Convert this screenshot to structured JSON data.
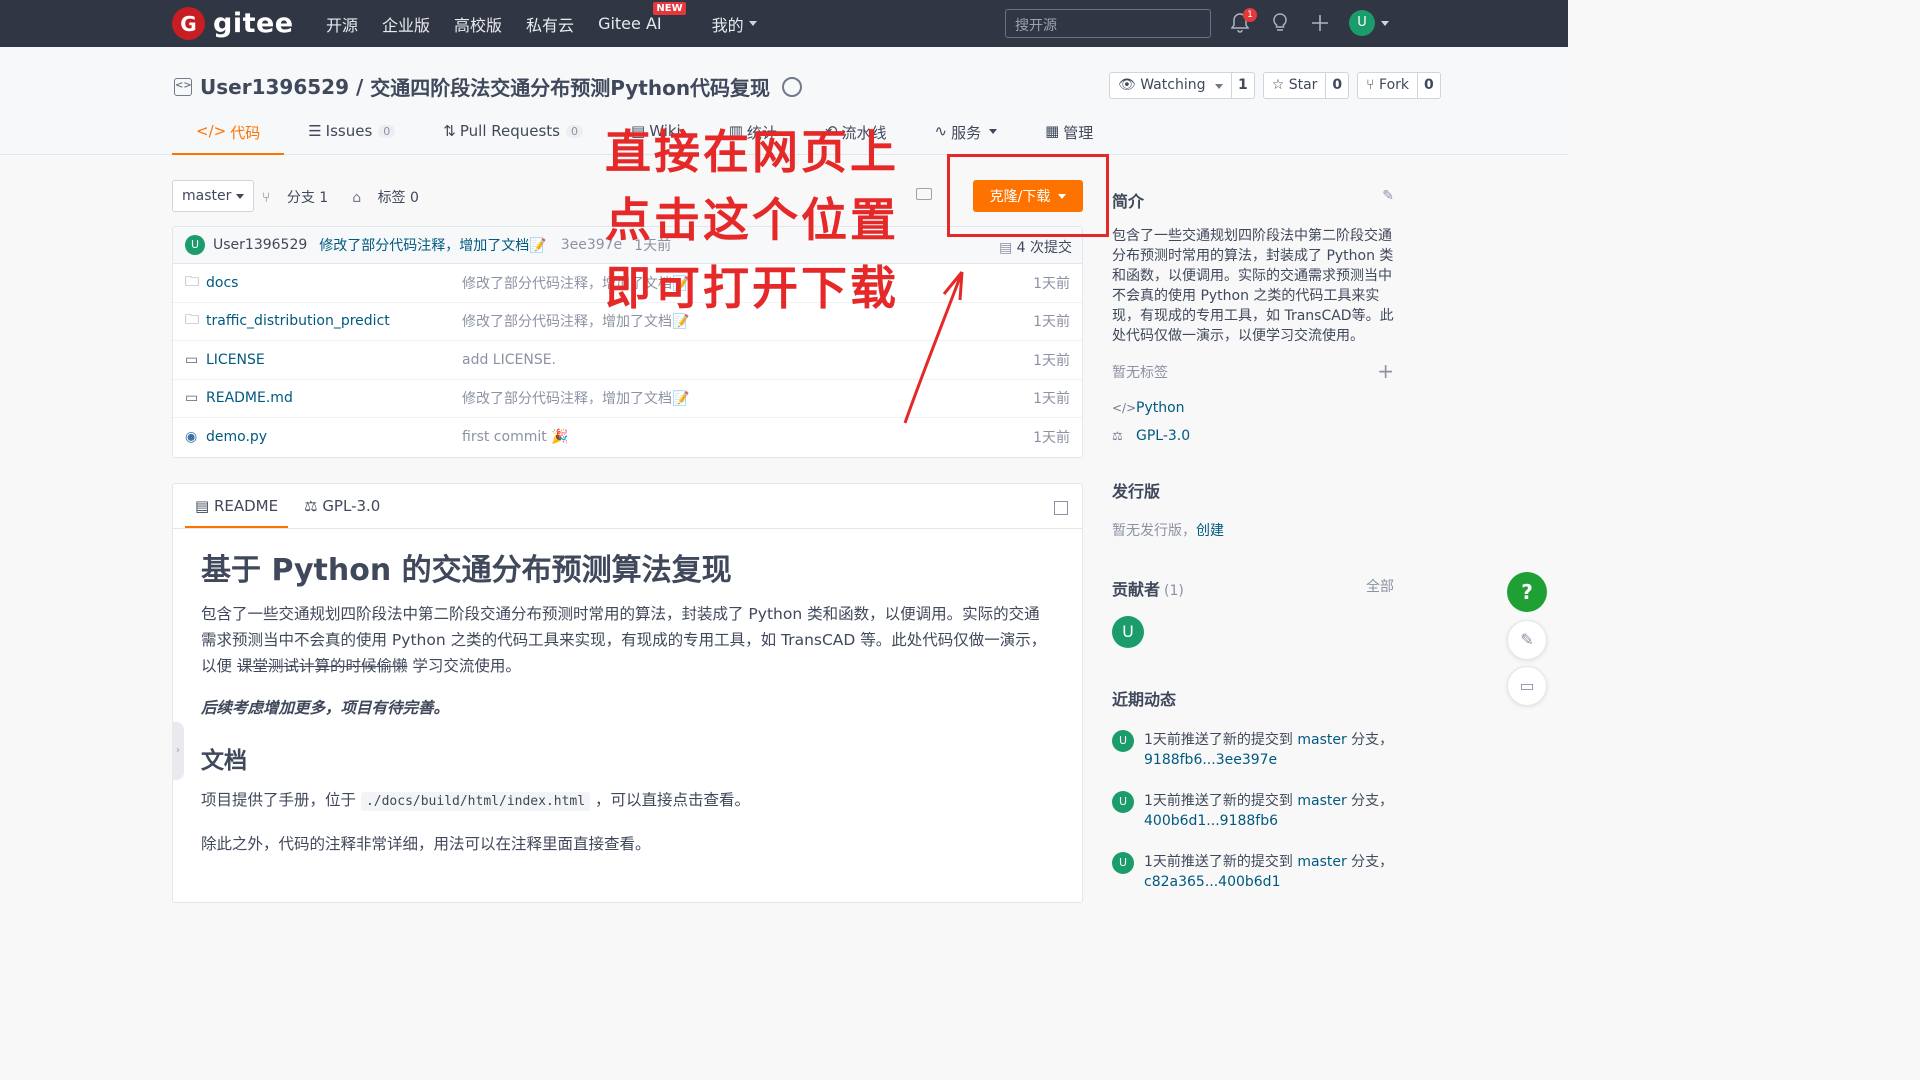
{
  "topbar": {
    "logo_glyph": "G",
    "logo_text": "gitee",
    "nav": [
      "开源",
      "企业版",
      "高校版",
      "私有云",
      "Gitee AI",
      "我的"
    ],
    "new_badge": "NEW",
    "search_placeholder": "搜开源",
    "notif_count": "1",
    "avatar_letter": "U"
  },
  "repo": {
    "owner": "User1396529",
    "separator": " / ",
    "name": "交通四阶段法交通分布预测Python代码复现",
    "watch_label": "Watching",
    "watch_count": "1",
    "star_label": "Star",
    "star_count": "0",
    "fork_label": "Fork",
    "fork_count": "0"
  },
  "tabs": {
    "code": "代码",
    "issues": "Issues",
    "issues_count": "0",
    "pr": "Pull Requests",
    "pr_count": "0",
    "wiki": "Wiki",
    "stats": "统计",
    "pipeline": "流水线",
    "services": "服务",
    "manage": "管理"
  },
  "toolbar": {
    "branch": "master",
    "branches": "分支 1",
    "tags": "标签 0",
    "clone": "克隆/下载"
  },
  "commit": {
    "avatar": "U",
    "user": "User1396529",
    "message": "修改了部分代码注释，增加了文档📝",
    "hash": "3ee397e",
    "time": "1天前",
    "count": "4 次提交"
  },
  "files": [
    {
      "icon": "folder-icon",
      "name": "docs",
      "message": "修改了部分代码注释，增加了文档📝",
      "time": "1天前"
    },
    {
      "icon": "folder-icon",
      "name": "traffic_distribution_predict",
      "message": "修改了部分代码注释，增加了文档📝",
      "time": "1天前"
    },
    {
      "icon": "book-icon",
      "name": "LICENSE",
      "message": "add LICENSE.",
      "time": "1天前"
    },
    {
      "icon": "book-icon",
      "name": "README.md",
      "message": "修改了部分代码注释，增加了文档📝",
      "time": "1天前"
    },
    {
      "icon": "python-icon",
      "name": "demo.py",
      "message": "first commit 🎉",
      "time": "1天前"
    }
  ],
  "readme": {
    "tab_readme": "README",
    "tab_license": "GPL-3.0",
    "h1": "基于 Python 的交通分布预测算法复现",
    "p1_a": "包含了一些交通规划四阶段法中第二阶段交通分布预测时常用的算法，封装成了 Python 类和函数，以便调用。实际的交通需求预测当中不会真的使用 Python 之类的代码工具来实现，有现成的专用工具，如 TransCAD 等。此处代码仅做一演示，以便 ",
    "p1_strike": "课堂测试计算的时候偷懒",
    "p1_b": " 学习交流使用。",
    "p2": "后续考虑增加更多，项目有待完善。",
    "h2": "文档",
    "p3_a": "项目提供了手册，位于 ",
    "p3_code": "./docs/build/html/index.html",
    "p3_b": " ，可以直接点击查看。",
    "p4": "除此之外，代码的注释非常详细，用法可以在注释里面直接查看。"
  },
  "sidebar": {
    "intro_title": "简介",
    "intro": "包含了一些交通规划四阶段法中第二阶段交通分布预测时常用的算法，封装成了 Python 类和函数，以便调用。实际的交通需求预测当中不会真的使用 Python 之类的代码工具来实现，有现成的专用工具，如 TransCAD等。此处代码仅做一演示，以便学习交流使用。",
    "no_tags": "暂无标签",
    "language": "Python",
    "license": "GPL-3.0",
    "release_title": "发行版",
    "no_release": "暂无发行版，",
    "create": "创建",
    "contrib_title": "贡献者",
    "contrib_count": "(1)",
    "all": "全部",
    "contrib_avatar": "U",
    "activity_title": "近期动态",
    "activities": [
      {
        "pre": "1天前推送了新的提交到 ",
        "branch": "master",
        "mid": " 分支，",
        "hash": "9188fb6...3ee397e"
      },
      {
        "pre": "1天前推送了新的提交到 ",
        "branch": "master",
        "mid": " 分支，",
        "hash": "400b6d1...9188fb6"
      },
      {
        "pre": "1天前推送了新的提交到 ",
        "branch": "master",
        "mid": " 分支，",
        "hash": "c82a365...400b6d1"
      }
    ]
  },
  "floating": {
    "help": "?"
  },
  "annotation": {
    "line1": "直接在网页上",
    "line2": "点击这个位置",
    "line3": "即可打开下载",
    "color": "#e52828"
  },
  "colors": {
    "accent": "#fe7300",
    "topbar": "#303643",
    "link": "#005980",
    "brand_red": "#c71d23"
  }
}
